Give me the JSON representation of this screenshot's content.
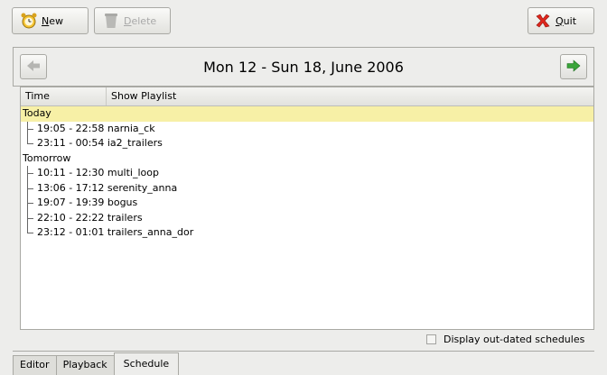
{
  "toolbar": {
    "new": {
      "label_underlined": "N",
      "label_rest": "ew",
      "icon": "alarm-clock-icon"
    },
    "delete": {
      "label_underlined": "D",
      "label_rest": "elete",
      "icon": "recycle-bin-icon"
    },
    "quit": {
      "label_underlined": "Q",
      "label_rest": "uit",
      "icon": "red-x-icon"
    }
  },
  "navigator": {
    "title": "Mon 12 - Sun 18, June 2006",
    "prev_icon": "left-arrow-icon",
    "next_icon": "right-arrow-icon"
  },
  "list": {
    "columns": {
      "time": "Time",
      "playlist": "Show Playlist"
    },
    "groups": [
      {
        "label": "Today",
        "selected": true,
        "items": [
          {
            "text": "19:05 - 22:58 narnia_ck"
          },
          {
            "text": "23:11 - 00:54 ia2_trailers"
          }
        ]
      },
      {
        "label": "Tomorrow",
        "selected": false,
        "items": [
          {
            "text": "10:11 - 12:30 multi_loop"
          },
          {
            "text": "13:06 - 17:12 serenity_anna"
          },
          {
            "text": "19:07 - 19:39 bogus"
          },
          {
            "text": "22:10 - 22:22 trailers"
          },
          {
            "text": "23:12 - 01:01 trailers_anna_dor"
          }
        ]
      }
    ]
  },
  "options": {
    "display_outdated": "Display out-dated schedules",
    "display_outdated_checked": false
  },
  "tabs": [
    {
      "label": "Editor",
      "active": false
    },
    {
      "label": "Playback",
      "active": false
    },
    {
      "label": "Schedule",
      "active": true
    }
  ],
  "colors": {
    "selection": "#f7f0a6",
    "next_arrow": "#3aa53a",
    "quit_x": "#e0261c"
  }
}
